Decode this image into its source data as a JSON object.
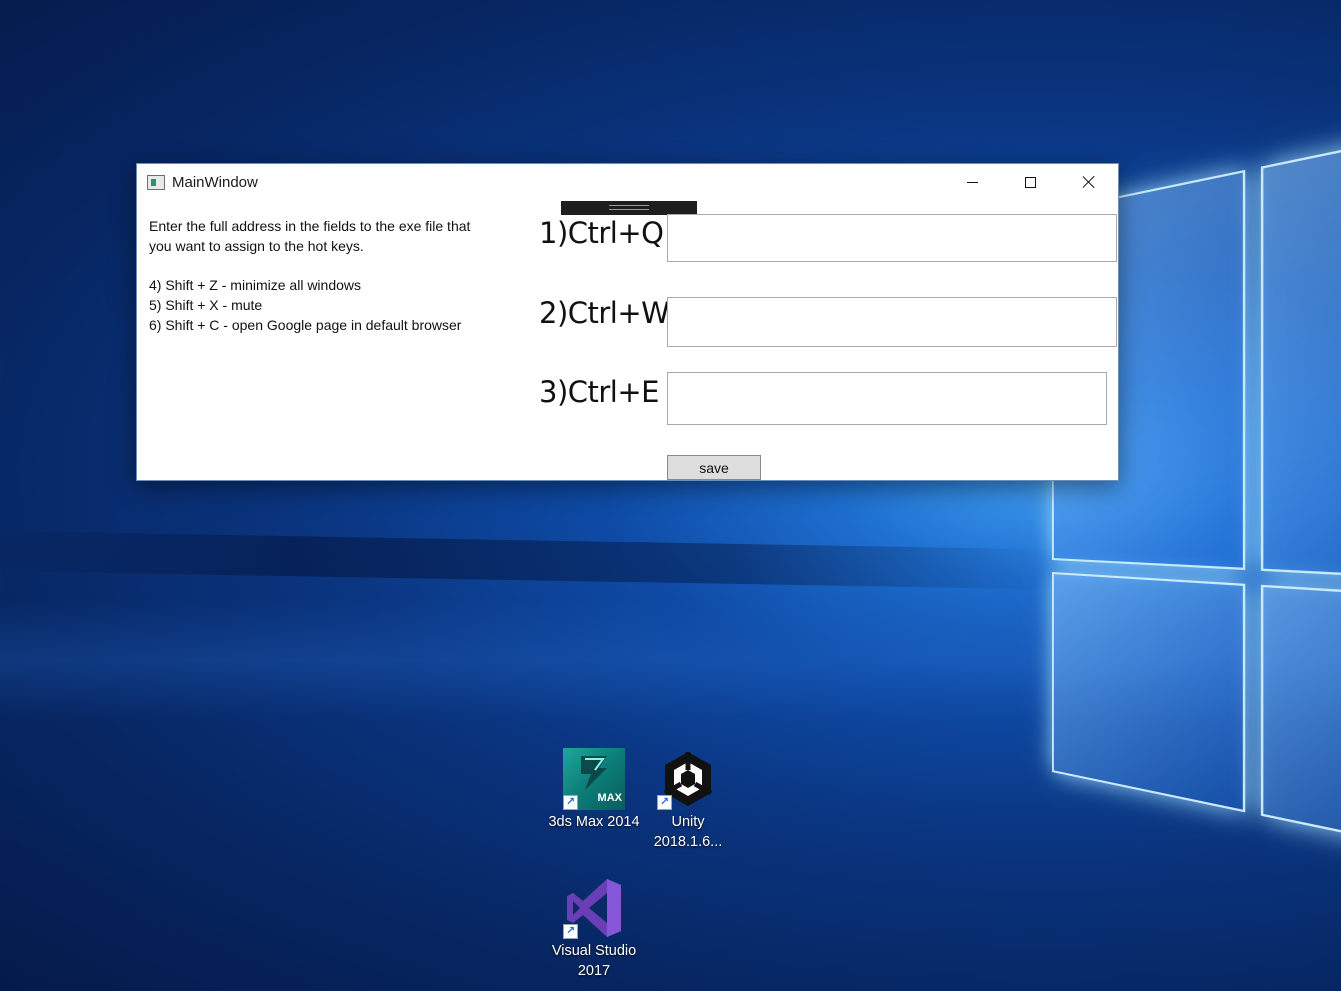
{
  "window": {
    "title": "MainWindow",
    "instructions": {
      "line1": "Enter the full address in the fields to the exe file that",
      "line2": "you want to assign to the hot keys.",
      "shortcut4": "4) Shift + Z - minimize all windows",
      "shortcut5": "5) Shift + X - mute",
      "shortcut6": "6) Shift + C - open Google page in default browser"
    },
    "hotkeys": [
      {
        "label": "1)Ctrl+Q",
        "value": ""
      },
      {
        "label": "2)Ctrl+W",
        "value": ""
      },
      {
        "label": "3)Ctrl+E",
        "value": ""
      }
    ],
    "save_label": "save"
  },
  "desktop": {
    "icons": [
      {
        "name": "3ds Max 2014",
        "badge": "MAX",
        "icon": "3ds-max-icon"
      },
      {
        "name_line1": "Unity",
        "name_line2": "2018.1.6...",
        "icon": "unity-icon"
      },
      {
        "name_line1": "Visual Studio",
        "name_line2": "2017",
        "icon": "visual-studio-icon"
      }
    ]
  }
}
